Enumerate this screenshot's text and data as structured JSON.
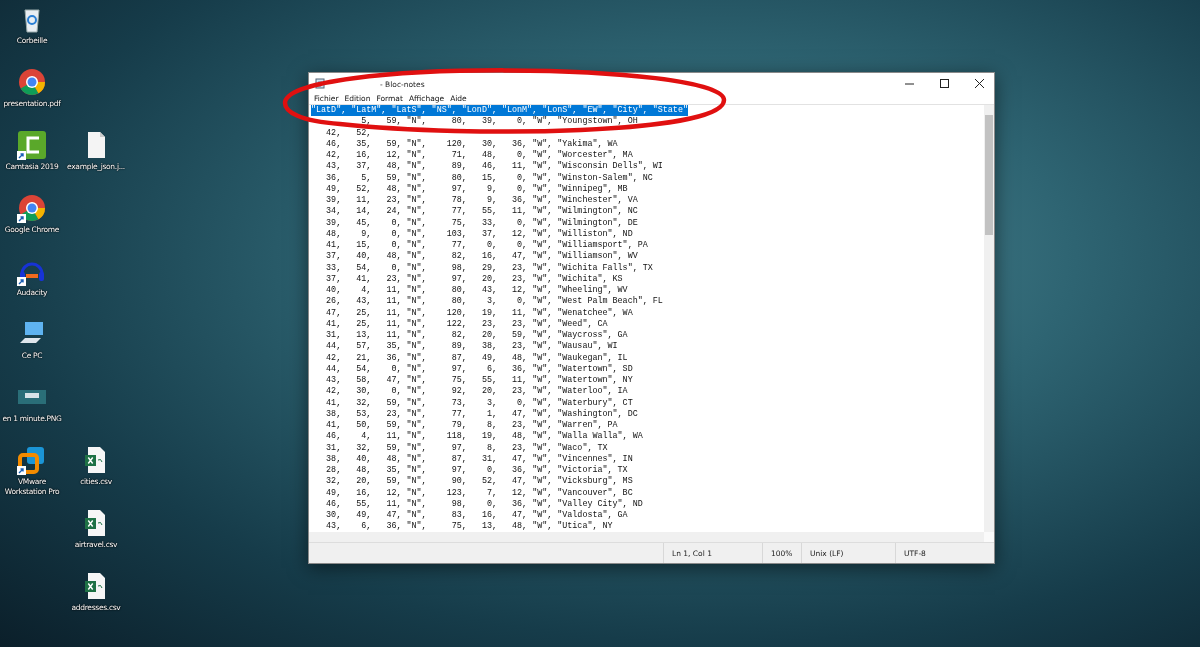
{
  "desktop": {
    "icons": [
      {
        "label": "Corbeille",
        "kind": "recycle-bin",
        "shortcut": false
      },
      {
        "label": "presentation.pdf",
        "kind": "chrome",
        "shortcut": false
      },
      {
        "label": "Camtasia 2019",
        "kind": "camtasia",
        "shortcut": true
      },
      {
        "label": "example_json.j...",
        "kind": "file",
        "shortcut": false
      },
      {
        "label": "Google Chrome",
        "kind": "chrome",
        "shortcut": true
      },
      {
        "label": "Audacity",
        "kind": "audacity",
        "shortcut": true
      },
      {
        "label": "Ce PC",
        "kind": "computer",
        "shortcut": false
      },
      {
        "label": "en 1 minute.PNG",
        "kind": "image",
        "shortcut": false
      },
      {
        "label": "VMware Workstation Pro",
        "kind": "vmware",
        "shortcut": true
      },
      {
        "label": "cities.csv",
        "kind": "spreadsheet",
        "shortcut": false
      },
      {
        "label": "airtravel.csv",
        "kind": "spreadsheet",
        "shortcut": false
      },
      {
        "label": "addresses.csv",
        "kind": "spreadsheet",
        "shortcut": false
      }
    ]
  },
  "window": {
    "title": "- Bloc-notes",
    "menu": [
      "Fichier",
      "Edition",
      "Format",
      "Affichage",
      "Aide"
    ],
    "lines": [
      {
        "text": "\"LatD\", \"LatM\", \"LatS\", \"NS\", \"LonD\", \"LonM\", \"LonS\", \"EW\", \"City\", \"State\"",
        "selected": true
      },
      {
        "text": "          5,   59, \"N\",     80,   39,    0, \"W\", \"Youngstown\", OH",
        "selected": false
      },
      {
        "text": "   42,   52,",
        "selected": false
      },
      {
        "text": "   46,   35,   59, \"N\",    120,   30,   36, \"W\", \"Yakima\", WA",
        "selected": false
      },
      {
        "text": "   42,   16,   12, \"N\",     71,   48,    0, \"W\", \"Worcester\", MA",
        "selected": false
      },
      {
        "text": "   43,   37,   48, \"N\",     89,   46,   11, \"W\", \"Wisconsin Dells\", WI",
        "selected": false
      },
      {
        "text": "   36,    5,   59, \"N\",     80,   15,    0, \"W\", \"Winston-Salem\", NC",
        "selected": false
      },
      {
        "text": "   49,   52,   48, \"N\",     97,    9,    0, \"W\", \"Winnipeg\", MB",
        "selected": false
      },
      {
        "text": "   39,   11,   23, \"N\",     78,    9,   36, \"W\", \"Winchester\", VA",
        "selected": false
      },
      {
        "text": "   34,   14,   24, \"N\",     77,   55,   11, \"W\", \"Wilmington\", NC",
        "selected": false
      },
      {
        "text": "   39,   45,    0, \"N\",     75,   33,    0, \"W\", \"Wilmington\", DE",
        "selected": false
      },
      {
        "text": "   48,    9,    0, \"N\",    103,   37,   12, \"W\", \"Williston\", ND",
        "selected": false
      },
      {
        "text": "   41,   15,    0, \"N\",     77,    0,    0, \"W\", \"Williamsport\", PA",
        "selected": false
      },
      {
        "text": "   37,   40,   48, \"N\",     82,   16,   47, \"W\", \"Williamson\", WV",
        "selected": false
      },
      {
        "text": "   33,   54,    0, \"N\",     98,   29,   23, \"W\", \"Wichita Falls\", TX",
        "selected": false
      },
      {
        "text": "   37,   41,   23, \"N\",     97,   20,   23, \"W\", \"Wichita\", KS",
        "selected": false
      },
      {
        "text": "   40,    4,   11, \"N\",     80,   43,   12, \"W\", \"Wheeling\", WV",
        "selected": false
      },
      {
        "text": "   26,   43,   11, \"N\",     80,    3,    0, \"W\", \"West Palm Beach\", FL",
        "selected": false
      },
      {
        "text": "   47,   25,   11, \"N\",    120,   19,   11, \"W\", \"Wenatchee\", WA",
        "selected": false
      },
      {
        "text": "   41,   25,   11, \"N\",    122,   23,   23, \"W\", \"Weed\", CA",
        "selected": false
      },
      {
        "text": "   31,   13,   11, \"N\",     82,   20,   59, \"W\", \"Waycross\", GA",
        "selected": false
      },
      {
        "text": "   44,   57,   35, \"N\",     89,   38,   23, \"W\", \"Wausau\", WI",
        "selected": false
      },
      {
        "text": "   42,   21,   36, \"N\",     87,   49,   48, \"W\", \"Waukegan\", IL",
        "selected": false
      },
      {
        "text": "   44,   54,    0, \"N\",     97,    6,   36, \"W\", \"Watertown\", SD",
        "selected": false
      },
      {
        "text": "   43,   58,   47, \"N\",     75,   55,   11, \"W\", \"Watertown\", NY",
        "selected": false
      },
      {
        "text": "   42,   30,    0, \"N\",     92,   20,   23, \"W\", \"Waterloo\", IA",
        "selected": false
      },
      {
        "text": "   41,   32,   59, \"N\",     73,    3,    0, \"W\", \"Waterbury\", CT",
        "selected": false
      },
      {
        "text": "   38,   53,   23, \"N\",     77,    1,   47, \"W\", \"Washington\", DC",
        "selected": false
      },
      {
        "text": "   41,   50,   59, \"N\",     79,    8,   23, \"W\", \"Warren\", PA",
        "selected": false
      },
      {
        "text": "   46,    4,   11, \"N\",    118,   19,   48, \"W\", \"Walla Walla\", WA",
        "selected": false
      },
      {
        "text": "   31,   32,   59, \"N\",     97,    8,   23, \"W\", \"Waco\", TX",
        "selected": false
      },
      {
        "text": "   38,   40,   48, \"N\",     87,   31,   47, \"W\", \"Vincennes\", IN",
        "selected": false
      },
      {
        "text": "   28,   48,   35, \"N\",     97,    0,   36, \"W\", \"Victoria\", TX",
        "selected": false
      },
      {
        "text": "   32,   20,   59, \"N\",     90,   52,   47, \"W\", \"Vicksburg\", MS",
        "selected": false
      },
      {
        "text": "   49,   16,   12, \"N\",    123,    7,   12, \"W\", \"Vancouver\", BC",
        "selected": false
      },
      {
        "text": "   46,   55,   11, \"N\",     98,    0,   36, \"W\", \"Valley City\", ND",
        "selected": false
      },
      {
        "text": "   30,   49,   47, \"N\",     83,   16,   47, \"W\", \"Valdosta\", GA",
        "selected": false
      },
      {
        "text": "   43,    6,   36, \"N\",     75,   13,   48, \"W\", \"Utica\", NY",
        "selected": false
      }
    ],
    "status": [
      "Ln 1, Col 1",
      "100%",
      "Unix (LF)",
      "UTF-8"
    ]
  }
}
